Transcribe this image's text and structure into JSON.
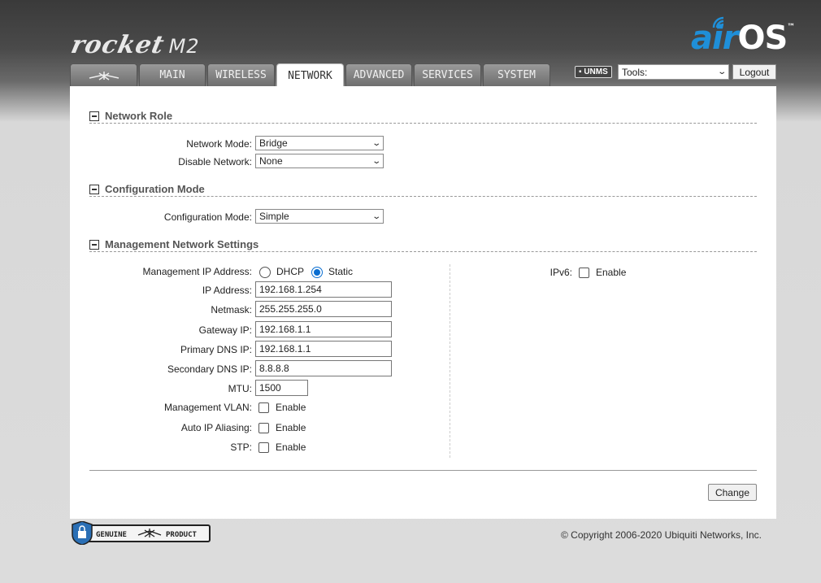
{
  "header": {
    "product_logo": "rocket",
    "product_model": "M2",
    "os_logo_air": "air",
    "os_logo_os": "OS",
    "os_logo_tm": "™"
  },
  "tabs": [
    {
      "label": "",
      "icon": "ubiquiti-logo-icon"
    },
    {
      "label": "MAIN"
    },
    {
      "label": "WIRELESS"
    },
    {
      "label": "NETWORK",
      "active": true
    },
    {
      "label": "ADVANCED"
    },
    {
      "label": "SERVICES"
    },
    {
      "label": "SYSTEM"
    }
  ],
  "toolbar": {
    "unms_label": "UNMS",
    "tools_value": "Tools:",
    "logout_label": "Logout"
  },
  "network_role": {
    "title": "Network Role",
    "network_mode_label": "Network Mode:",
    "network_mode_value": "Bridge",
    "disable_network_label": "Disable Network:",
    "disable_network_value": "None"
  },
  "configuration_mode": {
    "title": "Configuration Mode",
    "label": "Configuration Mode:",
    "value": "Simple"
  },
  "management": {
    "title": "Management Network Settings",
    "mgmt_ip_label": "Management IP Address:",
    "dhcp_label": "DHCP",
    "static_label": "Static",
    "selected": "Static",
    "ip_label": "IP Address:",
    "ip_value": "192.168.1.254",
    "netmask_label": "Netmask:",
    "netmask_value": "255.255.255.0",
    "gateway_label": "Gateway IP:",
    "gateway_value": "192.168.1.1",
    "primary_dns_label": "Primary DNS IP:",
    "primary_dns_value": "192.168.1.1",
    "secondary_dns_label": "Secondary DNS IP:",
    "secondary_dns_value": "8.8.8.8",
    "mtu_label": "MTU:",
    "mtu_value": "1500",
    "vlan_label": "Management VLAN:",
    "aliasing_label": "Auto IP Aliasing:",
    "stp_label": "STP:",
    "enable_label": "Enable",
    "ipv6_label": "IPv6:"
  },
  "actions": {
    "change_label": "Change"
  },
  "footer": {
    "genuine_left": "GENUINE",
    "genuine_right": "PRODUCT",
    "copyright": "© Copyright 2006-2020 Ubiquiti Networks, Inc."
  },
  "colors": {
    "accent": "#1f8fd8",
    "radio_selected": "#0a6ed1",
    "panel_bg": "#ffffff"
  }
}
